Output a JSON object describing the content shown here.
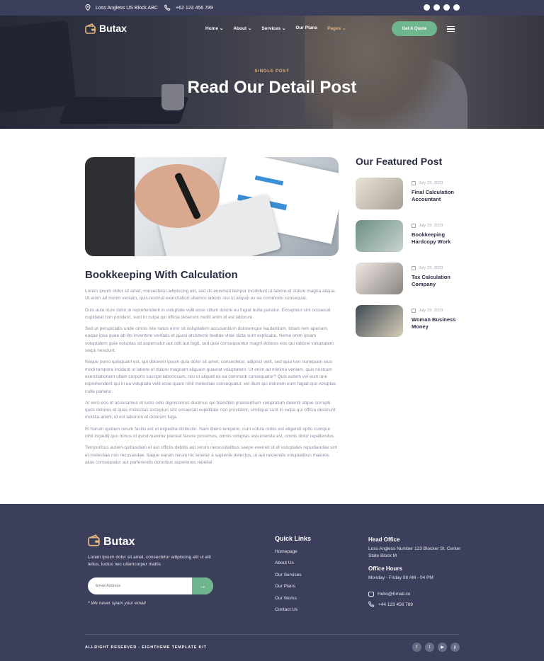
{
  "topbar": {
    "address": "Loss Angless US Block ABC",
    "phone": "+62 123 456 789",
    "social_icons": [
      "facebook-icon",
      "twitter-icon",
      "youtube-icon",
      "pinterest-icon"
    ]
  },
  "brand": {
    "name": "Butax",
    "accent": "#6fb58e",
    "gold": "#e0b47a",
    "navy": "#3c3f5c"
  },
  "nav": {
    "items": [
      {
        "label": "Home",
        "dropdown": true
      },
      {
        "label": "About",
        "dropdown": true
      },
      {
        "label": "Services",
        "dropdown": true
      },
      {
        "label": "Our Plans",
        "dropdown": false
      },
      {
        "label": "Pages",
        "dropdown": true,
        "active": true
      }
    ],
    "cta": "Get A Quote"
  },
  "hero": {
    "eyebrow": "SINGLE POST",
    "title": "Read Our Detail Post"
  },
  "article": {
    "title": "Bookkeeping With Calculation",
    "paragraphs": [
      "Lorem ipsum dolor sit amet, consectetur adipiscing elit, sed do eiusmod tempor incididunt ut labore et dolore magna aliqua. Ut enim ad minim veniam, quis nostrud exercitation ullamco laboris nisi ut aliquip ex ea commodo consequat.",
      "Duis aute irure dolor in reprehenderit in voluptate velit esse cillum dolore eu fugiat nulla pariatur. Excepteur sint occaecat cupidatat non proident, sunt in culpa qui officia deserunt mollit anim id est laborum.",
      "Sed ut perspiciatis unde omnis iste natus error sit voluptatem accusantium doloremque laudantium, totam rem aperiam, eaque ipsa quae ab illo inventore veritatis et quasi architecto beatae vitae dicta sunt explicabo. Nemo enim ipsam voluptatem quia voluptas sit aspernatur aut odit aut fugit, sed quia consequuntur magni dolores eos qui ratione voluptatem sequi nesciunt.",
      "Neque porro quisquam est, qui dolorem ipsum quia dolor sit amet, consectetur, adipisci velit, sed quia non numquam eius modi tempora incidunt ut labore et dolore magnam aliquam quaerat voluptatem. Ut enim ad minima veniam, quis nostrum exercitationem ullam corporis suscipit laboriosam, nisi ut aliquid ex ea commodi consequatur? Quis autem vel eum iure reprehenderit qui in ea voluptate velit esse quam nihil molestiae consequatur, vel illum qui dolorem eum fugiat quo voluptas nulla pariatur.",
      "At vero eos et accusamus et iusto odio dignissimos ducimus qui blanditiis praesentium voluptatum deleniti atque corrupti quos dolores et quas molestias excepturi sint occaecati cupiditate non provident, similique sunt in culpa qui officia deserunt mollitia animi, id est laborum et dolorum fuga.",
      "Et harum quidem rerum facilis est et expedita distinctio. Nam libero tempore, cum soluta nobis est eligendi optio cumque nihil impedit quo minus id quod maxime placeat facere possimus, omnis voluptas assumenda est, omnis dolor repellendus.",
      "Temporibus autem quibusdam et aut officiis debitis aut rerum necessitatibus saepe eveniet ut et voluptates repudiandae sint et molestiae non recusandae. Itaque earum rerum hic tenetur a sapiente delectus, ut aut reiciendis voluptatibus maiores alias consequatur aut perferendis doloribus asperiores repellat"
    ]
  },
  "featured": {
    "heading": "Our Featured Post",
    "posts": [
      {
        "date": "July 29, 2023",
        "title": "Final Calculation Accountant",
        "thumb": "#c9c2b8"
      },
      {
        "date": "July 29, 2023",
        "title": "Bookkeeping Hardcopy Work",
        "thumb": "#7b9a8e"
      },
      {
        "date": "July 29, 2023",
        "title": "Tax Calculation Company",
        "thumb": "#d9cfc6"
      },
      {
        "date": "July 29, 2023",
        "title": "Woman Business Money",
        "thumb": "#5c6670"
      }
    ]
  },
  "footer": {
    "brand": "Butax",
    "description": "Lorem ipsum dolor sit amet, consectetur adipiscing elit ut elit tellus, luctus nec ullamcorper mattis",
    "email_placeholder": "Email Address",
    "spam_note": "* We never spam your email",
    "quick_links_title": "Quick Links",
    "quick_links": [
      "Homepage",
      "About Us",
      "Our Services",
      "Our Plans",
      "Our Works",
      "Contact Us"
    ],
    "head_office_title": "Head Office",
    "head_office": "Loss Angless Number 123 Blocker St. Center State Block M",
    "hours_title": "Office Hours",
    "hours": "Monday - Friday 08 AM - 04 PM",
    "email": "Hello@Email.co",
    "phone": "+44 123 456 789",
    "copyright": "ALLRIGHT RESERVED - EIGHTHEME TEMPLATE KIT",
    "social_icons": [
      "facebook-icon",
      "twitter-icon",
      "youtube-icon",
      "pinterest-icon"
    ]
  }
}
